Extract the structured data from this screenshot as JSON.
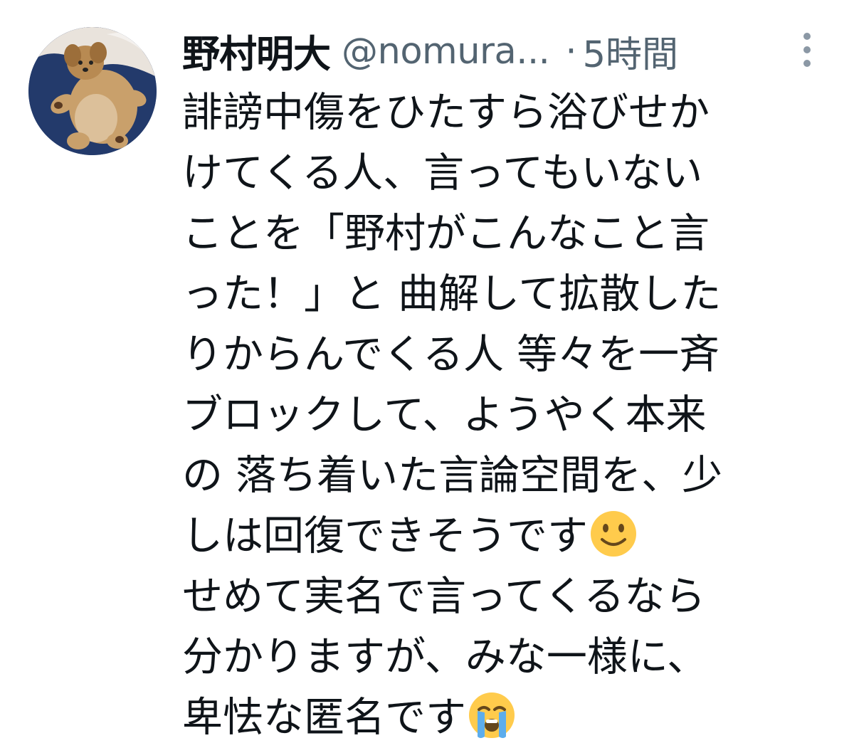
{
  "tweet": {
    "author": {
      "display_name": "野村明大",
      "handle": "@nomura...",
      "avatar": "dog-avatar"
    },
    "separator": "·",
    "timestamp": "5時間",
    "more_icon": "more-vertical-icon",
    "body_lines": [
      "誹謗中傷をひたすら浴びせか",
      "けてくる人、言ってもいない",
      "ことを「野村がこんなこと言",
      "った！」と 曲解して拡散した",
      "りからんでくる人 等々を一斉",
      "ブロックして、ようやく本来",
      "の 落ち着いた言論空間を、少",
      "しは回復できそうです",
      "せめて実名で言ってくるなら",
      "分かりますが、みな一様に、",
      "卑怯な匿名です"
    ],
    "emoji_1": "slightly-smiling-face-emoji",
    "emoji_2": "loudly-crying-face-emoji",
    "colors": {
      "text": "#0f1419",
      "secondary": "#536471",
      "emoji_yellow": "#ffcb4c"
    }
  }
}
